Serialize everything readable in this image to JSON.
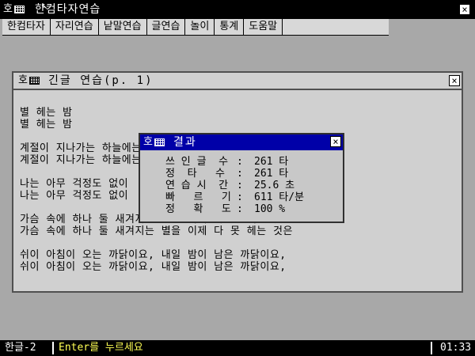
{
  "app": {
    "title_icon_glyph": "호",
    "title": "한컴타자연습",
    "close_glyph": "×"
  },
  "menu": {
    "items": [
      "한컴타자",
      "자리연습",
      "낱말연습",
      "글연습",
      "놀이",
      "통계",
      "도움말"
    ]
  },
  "practice_window": {
    "icon_glyph": "호",
    "title": "긴글 연습(p.  1)",
    "close_glyph": "×",
    "lines": [
      "별 헤는 밤",
      "별 헤는 밤",
      "",
      "계절이 지나가는 하늘에는",
      "계절이 지나가는 하늘에는",
      "",
      "나는 아무 걱정도 없이",
      "나는 아무 걱정도 없이",
      "",
      "가슴 속에 하나 둘 새겨지는 별을 이제 다 못 헤는 것은",
      "가슴 속에 하나 둘 새겨지는 별을 이제 다 못 헤는 것은",
      "",
      "쉬이 아침이 오는 까닭이요, 내일 밤이 남은 까닭이요,",
      "쉬이 아침이 오는 까닭이요, 내일 밤이 남은 까닭이요,"
    ]
  },
  "result_dialog": {
    "icon_glyph": "호",
    "title": "결과",
    "close_glyph": "×",
    "stats": [
      {
        "label": "쓰 인 글  수",
        "value": "261 타"
      },
      {
        "label": "정  타   수",
        "value": "261 타"
      },
      {
        "label": "연 습 시  간",
        "value": "25.6 초"
      },
      {
        "label": "빠   르   기",
        "value": "611 타/분"
      },
      {
        "label": "정   확   도",
        "value": "100 %"
      }
    ]
  },
  "statusbar": {
    "mode": "한글-2",
    "message": "Enter를 누르세요",
    "clock": "01:33"
  },
  "colors": {
    "desktop": "#a8a8a8",
    "titlebar": "#000000",
    "dialog_title": "#0000a8",
    "status_message": "#ffff55"
  }
}
